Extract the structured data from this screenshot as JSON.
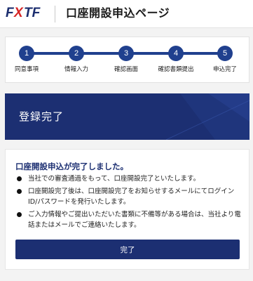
{
  "header": {
    "logo": "FXTF",
    "title": "口座開設申込ページ"
  },
  "steps": [
    {
      "number": "1",
      "label": "同意事項"
    },
    {
      "number": "2",
      "label": "情報入力"
    },
    {
      "number": "3",
      "label": "確認画面"
    },
    {
      "number": "4",
      "label": "確認書類提出"
    },
    {
      "number": "5",
      "label": "申込完了"
    }
  ],
  "current_step": 5,
  "banner": {
    "title": "登録完了"
  },
  "content": {
    "heading": "口座開設申込が完了しました。",
    "bullets": [
      "当社での審査通過をもって、口座開設完了といたします。",
      "口座開設完了後は、口座開設完了をお知らせするメールにてログインID/パスワードを発行いたします。",
      "ご入力情報やご提出いただいた書類に不備等がある場合は、当社より電話またはメールでご連絡いたします。"
    ],
    "button_label": "完了"
  },
  "colors": {
    "brand_navy": "#1c2f72",
    "step_blue": "#20408e",
    "logo_red": "#d62626"
  }
}
